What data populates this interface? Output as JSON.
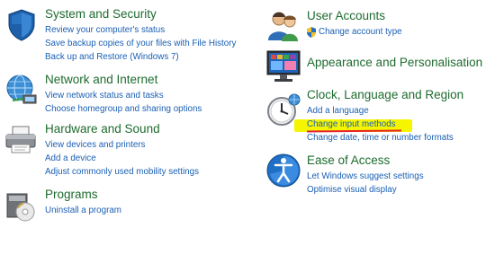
{
  "left": [
    {
      "title": "System and Security",
      "icon": "shield-icon",
      "links": [
        "Review your computer's status",
        "Save backup copies of your files with File History",
        "Back up and Restore (Windows 7)"
      ]
    },
    {
      "title": "Network and Internet",
      "icon": "globe-network-icon",
      "links": [
        "View network status and tasks",
        "Choose homegroup and sharing options"
      ]
    },
    {
      "title": "Hardware and Sound",
      "icon": "printer-icon",
      "links": [
        "View devices and printers",
        "Add a device",
        "Adjust commonly used mobility settings"
      ]
    },
    {
      "title": "Programs",
      "icon": "programs-disc-icon",
      "links": [
        "Uninstall a program"
      ]
    }
  ],
  "right": [
    {
      "title": "User Accounts",
      "icon": "users-icon",
      "links": [
        "Change account type"
      ]
    },
    {
      "title": "Appearance and Personalisation",
      "icon": "monitor-icon",
      "links": []
    },
    {
      "title": "Clock, Language and Region",
      "icon": "clock-icon",
      "links": [
        "Add a language",
        "Change input methods",
        "Change date, time or number formats"
      ]
    },
    {
      "title": "Ease of Access",
      "icon": "ease-of-access-icon",
      "links": [
        "Let Windows suggest settings",
        "Optimise visual display"
      ]
    }
  ],
  "colors": {
    "title_green": "#1e6b2e",
    "link_blue": "#1a5fb4",
    "highlight_yellow": "#f5f500",
    "underline_red": "#e8232a"
  }
}
